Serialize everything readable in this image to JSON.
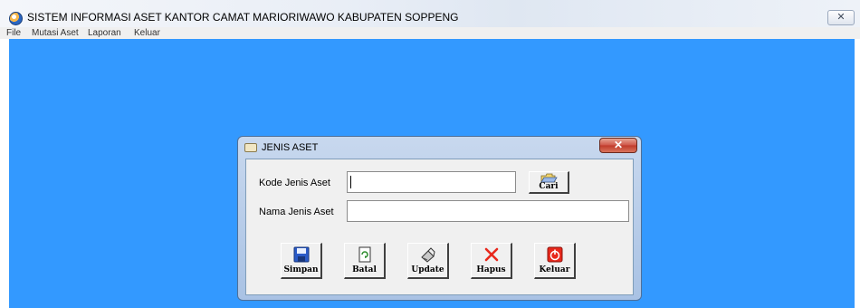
{
  "window": {
    "title": "SISTEM INFORMASI ASET KANTOR CAMAT MARIORIWAWO KABUPATEN SOPPENG",
    "close_glyph": "✕",
    "icon": "app-icon"
  },
  "menu": {
    "items": [
      {
        "label": "File"
      },
      {
        "label": "Mutasi Aset"
      },
      {
        "label": "Laporan"
      },
      {
        "label": "Keluar"
      }
    ]
  },
  "dialog": {
    "title": "JENIS ASET",
    "close_glyph": "✕",
    "fields": {
      "kode": {
        "label": "Kode Jenis Aset",
        "value": ""
      },
      "nama": {
        "label": "Nama Jenis Aset",
        "value": ""
      }
    },
    "search_button": {
      "label": "Cari",
      "icon": "open-folder-icon"
    },
    "buttons": [
      {
        "label": "Simpan",
        "icon": "floppy-disk-icon"
      },
      {
        "label": "Batal",
        "icon": "document-icon"
      },
      {
        "label": "Update",
        "icon": "pen-icon"
      },
      {
        "label": "Hapus",
        "icon": "delete-x-icon"
      },
      {
        "label": "Keluar",
        "icon": "power-icon"
      }
    ]
  },
  "colors": {
    "desktop": "#3399ff",
    "dialog_close": "#c03a2b",
    "hapus_icon": "#e8281c",
    "keluar_icon": "#e8281c"
  }
}
